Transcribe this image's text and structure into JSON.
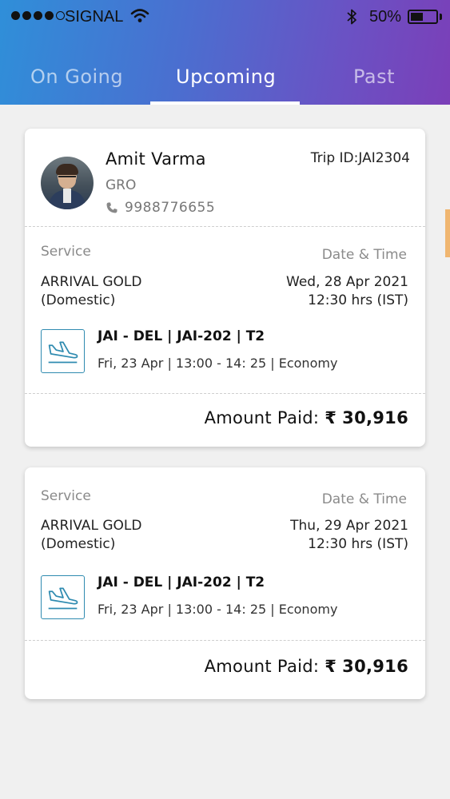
{
  "status_bar": {
    "carrier": "SIGNAL",
    "battery": "50%"
  },
  "tabs": [
    {
      "label": "On Going"
    },
    {
      "label": "Upcoming"
    },
    {
      "label": "Past"
    }
  ],
  "bookings": [
    {
      "customer": {
        "name": "Amit Varma",
        "role": "GRO",
        "phone": "9988776655"
      },
      "trip_id": "Trip ID:JAI2304",
      "service_label": "Service",
      "service_line1": "ARRIVAL GOLD",
      "service_line2": "(Domestic)",
      "datetime_label": "Date & Time",
      "date": "Wed, 28 Apr 2021",
      "time": "12:30 hrs (IST)",
      "flight_route": "JAI - DEL | JAI-202 | T2",
      "flight_detail": "Fri, 23 Apr | 13:00 - 14: 25 | Economy",
      "amount_label": "Amount Paid:",
      "currency": "₹",
      "amount": "30,916"
    },
    {
      "service_label": "Service",
      "service_line1": "ARRIVAL GOLD",
      "service_line2": "(Domestic)",
      "datetime_label": "Date & Time",
      "date": "Thu, 29 Apr 2021",
      "time": "12:30 hrs (IST)",
      "flight_route": "JAI - DEL | JAI-202 | T2",
      "flight_detail": "Fri, 23 Apr | 13:00 - 14: 25 | Economy",
      "amount_label": "Amount Paid:",
      "currency": "₹",
      "amount": "30,916"
    }
  ],
  "icons": {
    "signal": "signal-dots-icon",
    "wifi": "wifi-icon",
    "bluetooth": "bluetooth-icon",
    "battery": "battery-icon",
    "phone": "phone-icon",
    "flight": "flight-landing-icon",
    "avatar": "avatar"
  },
  "colors": {
    "header_gradient_start": "#2f8fd9",
    "header_gradient_end": "#7b3fb8",
    "flight_icon": "#2f8bb0"
  }
}
